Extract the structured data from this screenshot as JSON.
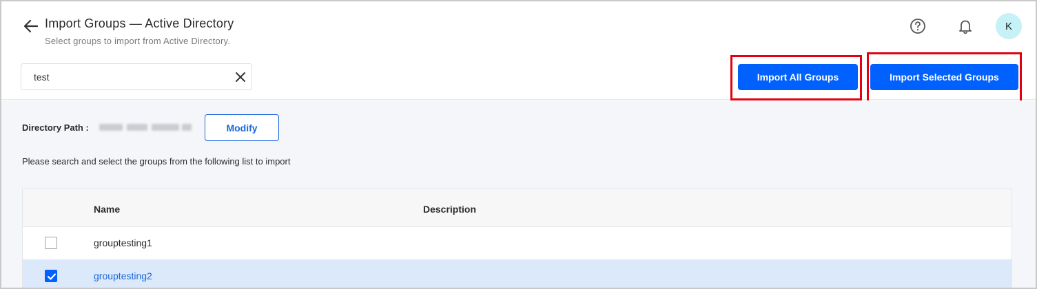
{
  "header": {
    "title": "Import Groups — Active Directory",
    "subtitle": "Select groups to import from Active Directory.",
    "avatar_initial": "K"
  },
  "search": {
    "value": "test",
    "placeholder": ""
  },
  "actions": {
    "import_all_label": "Import All Groups",
    "import_selected_label": "Import Selected Groups"
  },
  "directory": {
    "label": "Directory Path :",
    "modify_label": "Modify"
  },
  "instruction": "Please search and select the groups from the following list to import",
  "table": {
    "columns": [
      "Name",
      "Description"
    ],
    "rows": [
      {
        "name": "grouptesting1",
        "description": "",
        "selected": false
      },
      {
        "name": "grouptesting2",
        "description": "",
        "selected": true
      }
    ]
  },
  "colors": {
    "primary": "#0061fe",
    "highlight": "#e3000f",
    "selected_row": "#dce9fb",
    "avatar_bg": "#c6f1f6"
  },
  "icons": [
    "back-arrow-icon",
    "help-circle-icon",
    "bell-icon",
    "close-icon",
    "checkmark-icon"
  ]
}
